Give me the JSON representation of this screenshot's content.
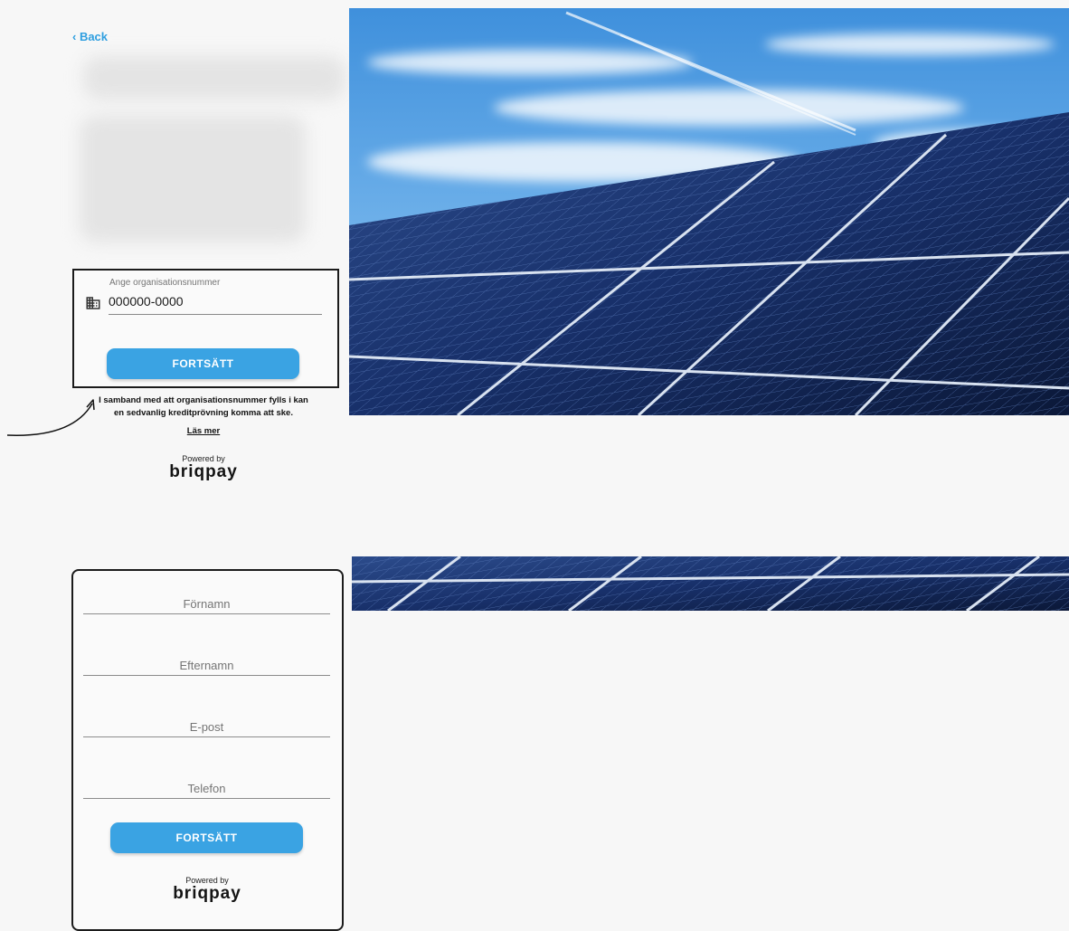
{
  "back_link": "‹ Back",
  "org_form": {
    "label": "Ange organisationsnummer",
    "input_value": "000000-0000",
    "button_label": "FORTSÄTT",
    "notice": "I samband med att organisationsnummer fylls i kan en sedvanlig kreditprövning komma att ske.",
    "read_more": "Läs mer"
  },
  "powered_by": {
    "small": "Powered by",
    "brand": "briqpay"
  },
  "contact_form": {
    "first_name_placeholder": "Förnamn",
    "last_name_placeholder": "Efternamn",
    "email_placeholder": "E-post",
    "phone_placeholder": "Telefon",
    "button_label": "FORTSÄTT"
  },
  "colors": {
    "accent": "#3aa3e3",
    "back_link": "#2f9fe0",
    "border": "#1b1b1b"
  },
  "icons": {
    "org_field": "building-icon",
    "annotation": "curved-arrow-icon",
    "hero": "solar-panels-image"
  }
}
